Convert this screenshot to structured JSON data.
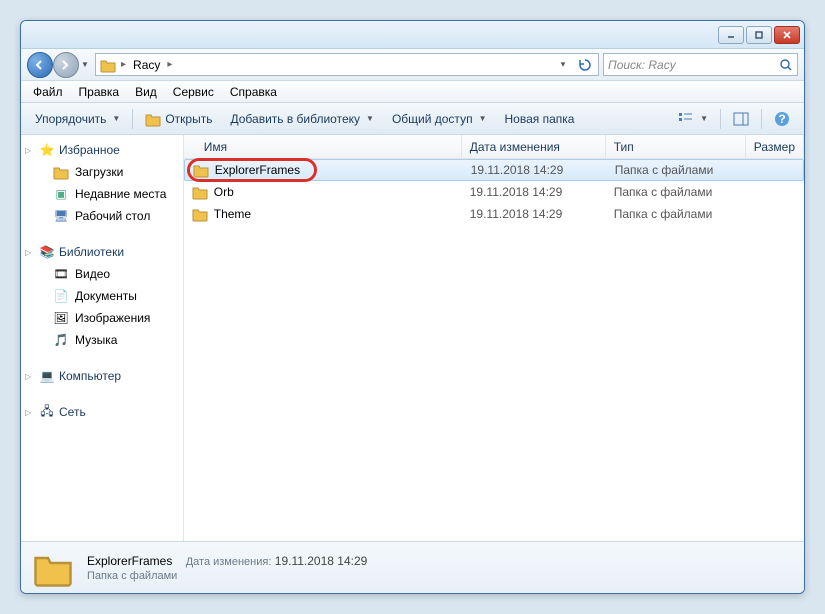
{
  "titlebar": {},
  "nav": {
    "breadcrumb": "Racy",
    "search_placeholder": "Поиск: Racy"
  },
  "menubar": {
    "file": "Файл",
    "edit": "Правка",
    "view": "Вид",
    "tools": "Сервис",
    "help": "Справка"
  },
  "toolbar": {
    "organize": "Упорядочить",
    "open": "Открыть",
    "add_library": "Добавить в библиотеку",
    "share": "Общий доступ",
    "new_folder": "Новая папка"
  },
  "sidebar": {
    "favorites": {
      "label": "Избранное",
      "downloads": "Загрузки",
      "recent": "Недавние места",
      "desktop": "Рабочий стол"
    },
    "libraries": {
      "label": "Библиотеки",
      "video": "Видео",
      "documents": "Документы",
      "pictures": "Изображения",
      "music": "Музыка"
    },
    "computer": {
      "label": "Компьютер"
    },
    "network": {
      "label": "Сеть"
    }
  },
  "columns": {
    "name": "Имя",
    "date": "Дата изменения",
    "type": "Тип",
    "size": "Размер"
  },
  "rows": [
    {
      "name": "ExplorerFrames",
      "date": "19.11.2018 14:29",
      "type": "Папка с файлами",
      "selected": true
    },
    {
      "name": "Orb",
      "date": "19.11.2018 14:29",
      "type": "Папка с файлами",
      "selected": false
    },
    {
      "name": "Theme",
      "date": "19.11.2018 14:29",
      "type": "Папка с файлами",
      "selected": false
    }
  ],
  "details": {
    "name": "ExplorerFrames",
    "date_label": "Дата изменения:",
    "date": "19.11.2018 14:29",
    "type": "Папка с файлами"
  },
  "annotation": {
    "ring_target": "ExplorerFrames"
  }
}
